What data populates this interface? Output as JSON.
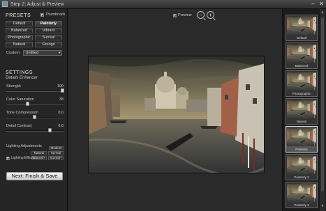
{
  "window": {
    "title": "Step 2: Adjust & Preview",
    "minimize": "–",
    "close": "✕"
  },
  "presets": {
    "title": "PRESETS",
    "thumbnails_label": "Thumbnails",
    "buttons": [
      "Default",
      "Painterly",
      "Balanced",
      "Vibrant",
      "Photographic",
      "Surreal",
      "Natural",
      "Grunge"
    ],
    "active": "Painterly",
    "custom_label": "Custom:",
    "custom_value": "Untitled"
  },
  "settings": {
    "title": "SETTINGS",
    "subtitle": "Details Enhancer",
    "sliders": [
      {
        "label": "Strength",
        "value": "100",
        "level": 1.0
      },
      {
        "label": "Color Saturation",
        "value": "38",
        "level": 0.38
      },
      {
        "label": "Tone Compression",
        "value": "0.0",
        "level": 0.5
      },
      {
        "label": "Detail Contrast",
        "value": "6.0",
        "level": 0.78
      }
    ],
    "lighting": {
      "title": "Lighting Adjustments",
      "buttons": [
        "Medium",
        "Natural",
        "Surreal",
        "Natural+",
        "Surreal+"
      ],
      "effects_label": "Lighting Effects"
    },
    "finish_button": "Next: Finish & Save"
  },
  "toolbar": {
    "preview_label": "Preview",
    "zoom_out": "−",
    "zoom_in": "+"
  },
  "thumbnails": [
    {
      "label": "Default"
    },
    {
      "label": "Balanced"
    },
    {
      "label": "Photographic"
    },
    {
      "label": "Natural"
    },
    {
      "label": "Painterly"
    },
    {
      "label": "Painterly 2"
    },
    {
      "label": "Painterly 3"
    }
  ],
  "colors": {
    "accent": "#ffffff",
    "panel": "#252525",
    "background": "#1e1e1e"
  },
  "icons": [
    "app-icon",
    "minimize-icon",
    "close-icon",
    "zoom-out-icon",
    "zoom-in-icon",
    "checkbox-icon"
  ]
}
